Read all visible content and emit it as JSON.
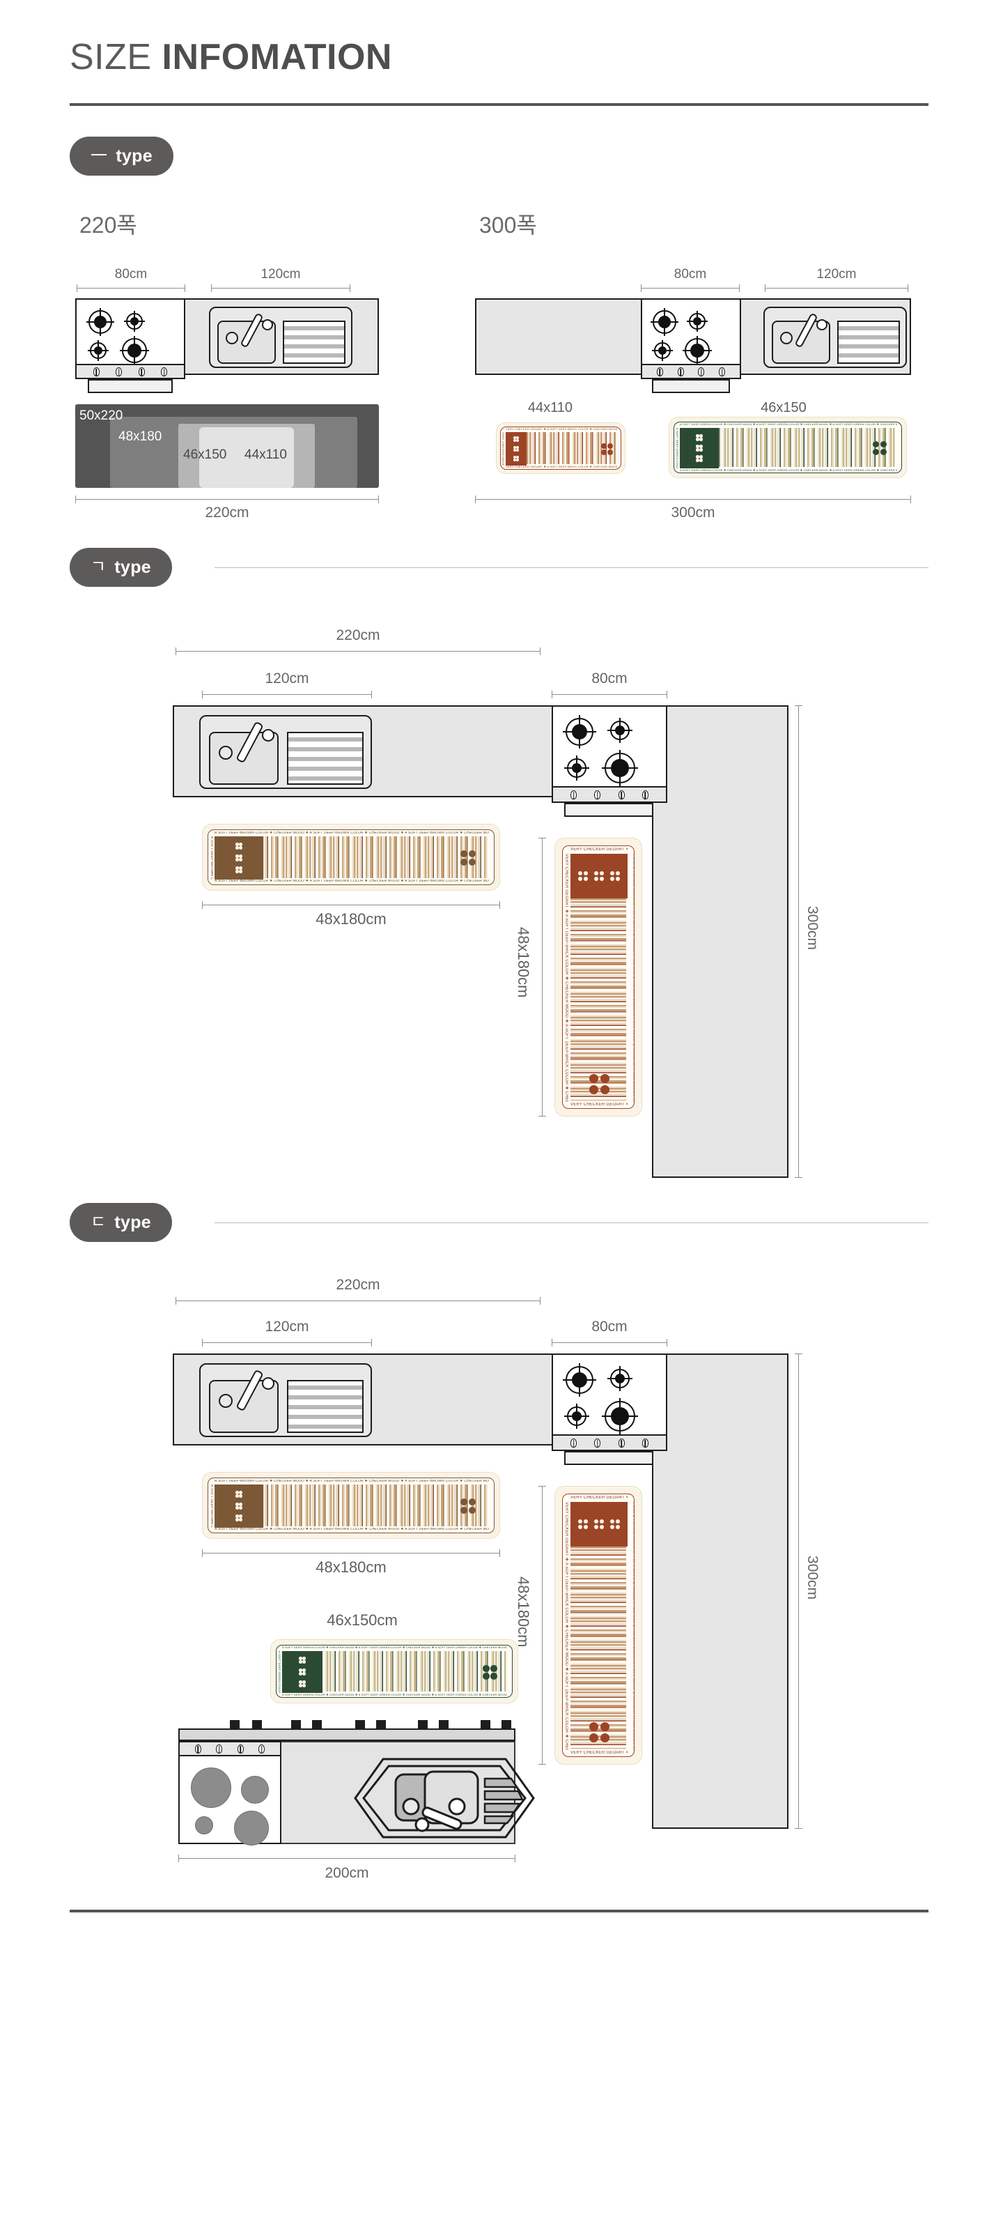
{
  "header": {
    "title_light": "SIZE",
    "title_bold": "INFOMATION"
  },
  "sections": [
    {
      "id": "type-line",
      "badge_glyph": "一",
      "badge_label": "type",
      "columns": [
        {
          "id": "w220",
          "title": "220폭",
          "top_dims": [
            "80cm",
            "120cm"
          ],
          "baseline": "220cm",
          "nesting": [
            {
              "label": "50x220",
              "tone": "#545454",
              "text_color": "#ffffff"
            },
            {
              "label": "48x180",
              "tone": "#7e7e7e",
              "text_color": "#ffffff"
            },
            {
              "label": "46x150",
              "tone": "#b5b5b5",
              "text_color": "#4a4a4a"
            },
            {
              "label": "44x110",
              "tone": "#e3e3e3",
              "text_color": "#4a4a4a"
            }
          ]
        },
        {
          "id": "w300",
          "title": "300폭",
          "top_dims": [
            "80cm",
            "120cm"
          ],
          "baseline": "300cm",
          "mats": [
            {
              "label": "44x110",
              "theme": "rust"
            },
            {
              "label": "46x150",
              "theme": "green"
            }
          ]
        }
      ]
    },
    {
      "id": "type-giyeok",
      "badge_glyph": "ㄱ",
      "badge_label": "type",
      "dims": {
        "total_top": "220cm",
        "sink_span": "120cm",
        "hob_span": "80cm",
        "right_vertical": "300cm",
        "vertical_mat": "48x180cm"
      },
      "mats": [
        {
          "label": "48x180cm",
          "theme": "brown",
          "orientation": "horizontal"
        },
        {
          "label": "48x180cm",
          "theme": "rust",
          "orientation": "vertical"
        }
      ]
    },
    {
      "id": "type-digeut",
      "badge_glyph": "ㄷ",
      "badge_label": "type",
      "dims": {
        "total_top": "220cm",
        "sink_span": "120cm",
        "hob_span": "80cm",
        "right_vertical": "300cm",
        "vertical_mat": "48x180cm",
        "bottom_span": "200cm"
      },
      "mats": [
        {
          "label": "48x180cm",
          "theme": "brown",
          "orientation": "horizontal"
        },
        {
          "label": "46x150cm",
          "theme": "green",
          "orientation": "horizontal"
        },
        {
          "label": "48x180cm",
          "theme": "rust",
          "orientation": "vertical"
        }
      ]
    }
  ],
  "mat_edge_text": {
    "brown": "A SOFT DEEP-BROWN COLOR ❖ CHECKER MOOD ❖ A SOFT DEEP-BROWN COLOR ❖ CHECKER MOOD ❖ A SOFT DEEP-BROWN COLOR ❖ CHECKER MOOD ❖ A SOFT DEEP-BROWN COLOR",
    "rust": "VERY CHECKER GEOART ❖ A SOFT DEEP-BRICK COLOR ❖ CHECKER MOOD ❖ A SOFT DEEP-BRICK COLOR ❖ CHECKER MOOD ❖ A SOFT DEEP-BRICK COLOR",
    "green": "A SOFT DEEP-GREEN COLOR ❖ CHECKER MOOD ❖ A SOFT DEEP-GREEN COLOR ❖ CHECKER MOOD ❖ A SOFT DEEP-GREEN COLOR ❖ CHECKER MOOD ❖ A SOFT DEEP-GREEN COLOR"
  },
  "colors": {
    "ink": "#555555",
    "counter_fill": "#e6e6e6",
    "counter_stroke": "#1d1d1d",
    "badge_bg": "#5d5b59",
    "mat_cream": "#fbf4e6",
    "theme_brown": "#7c5836",
    "theme_rust": "#9c4426",
    "theme_green": "#2b4a34"
  }
}
